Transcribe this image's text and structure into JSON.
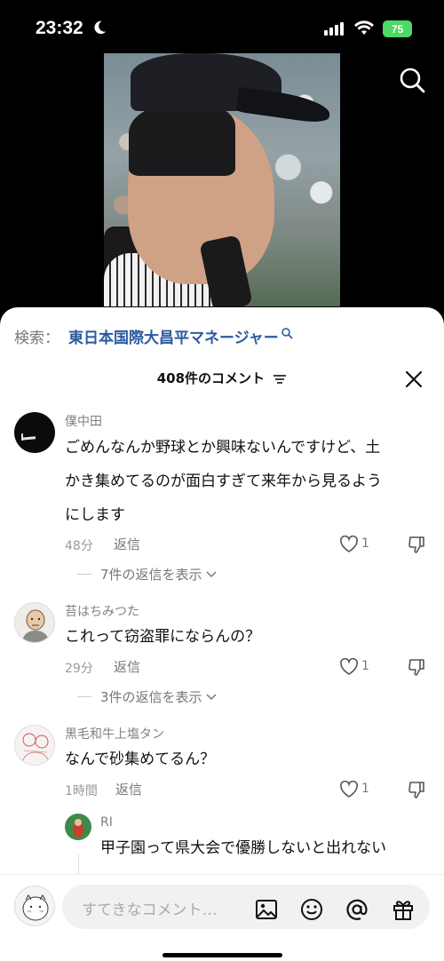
{
  "status": {
    "time": "23:32",
    "battery": "75"
  },
  "search": {
    "label": "検索：",
    "query": "東日本国際大昌平マネージャー"
  },
  "comments_header": {
    "title": "408件のコメント"
  },
  "comments": [
    {
      "user": "僕中田",
      "lines": [
        "ごめんなんか野球とか興味ないんですけど、土",
        "かき集めてるのが面白すぎて来年から見るよう",
        "にします"
      ],
      "time": "48分",
      "reply": "返信",
      "likes": "1",
      "view_replies": "7件の返信を表示"
    },
    {
      "user": "苔はちみつた",
      "lines": [
        "これって窃盗罪にならんの？"
      ],
      "time": "29分",
      "reply": "返信",
      "likes": "1",
      "view_replies": "3件の返信を表示"
    },
    {
      "user": "黒毛和牛上塩タン",
      "lines": [
        "なんで砂集めてるん？"
      ],
      "time": "1時間",
      "reply": "返信",
      "likes": "1"
    }
  ],
  "nested_reply": {
    "user": "RI",
    "text": "甲子園って県大会で優勝しないと出れない"
  },
  "input": {
    "placeholder": "すてきなコメント…"
  },
  "colors": {
    "accent_link": "#2c5aa0",
    "battery": "#4cd964"
  }
}
